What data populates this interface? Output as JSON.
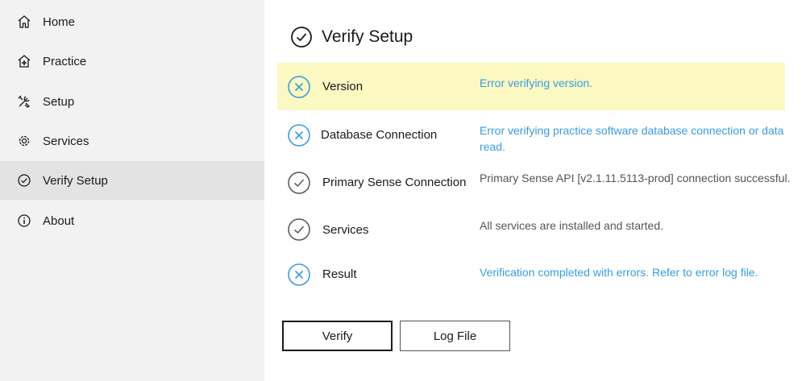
{
  "sidebar": {
    "items": [
      {
        "label": "Home",
        "icon": "home-icon"
      },
      {
        "label": "Practice",
        "icon": "practice-icon"
      },
      {
        "label": "Setup",
        "icon": "tools-icon"
      },
      {
        "label": "Services",
        "icon": "gear-icon"
      },
      {
        "label": "Verify Setup",
        "icon": "check-circle-icon",
        "active": true
      },
      {
        "label": "About",
        "icon": "info-icon"
      }
    ]
  },
  "main": {
    "title": "Verify Setup",
    "checks": [
      {
        "label": "Version",
        "status": "error",
        "message": "Error verifying version."
      },
      {
        "label": "Database Connection",
        "status": "error",
        "message": "Error verifying practice software database connection or data read."
      },
      {
        "label": "Primary Sense Connection",
        "status": "ok",
        "message": "Primary Sense API [v2.1.11.5113-prod] connection successful."
      },
      {
        "label": "Services",
        "status": "ok",
        "message": "All services are installed and started."
      },
      {
        "label": "Result",
        "status": "error",
        "message": "Verification completed with errors. Refer to error log file."
      }
    ],
    "buttons": {
      "verify": "Verify",
      "log_file": "Log File"
    }
  },
  "colors": {
    "error": "#3a9ce0",
    "highlight": "#fbf8c2",
    "sidebar_bg": "#f2f2f2",
    "sidebar_active": "#e3e3e3"
  }
}
